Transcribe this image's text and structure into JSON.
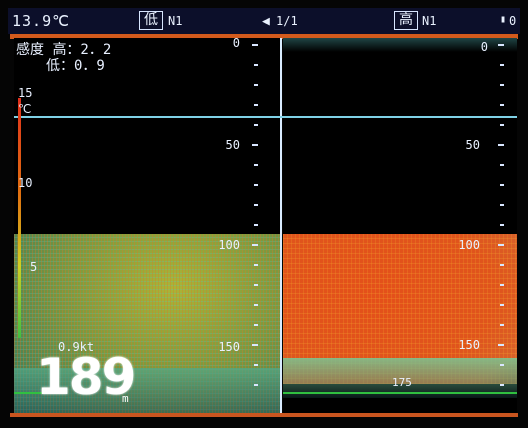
{
  "header": {
    "water_temp": "13.9℃",
    "low_freq_label": "低",
    "low_mode": "N1",
    "page_indicator": "1/1",
    "high_freq_label": "高",
    "high_mode": "N1",
    "corner_value": "0"
  },
  "gain": {
    "label": "感度",
    "high": "高：2．2",
    "low": "低：0．9"
  },
  "temp_scale": [
    "15",
    "℃",
    "10",
    "5"
  ],
  "left_scale": {
    "top": "0",
    "mid": "50",
    "deep": "100",
    "deeper": "150"
  },
  "right_scale": {
    "top": "0",
    "mid": "50",
    "deep": "100",
    "deeper": "150",
    "bottom_label": "175"
  },
  "speed": "0.9kt",
  "depth": {
    "value": "189",
    "unit": "m"
  },
  "colors": {
    "strong_echo": "#e4501a",
    "weak_echo": "#9fcf5a",
    "line": "#7fd1e6",
    "marker": "#d35a1c"
  }
}
